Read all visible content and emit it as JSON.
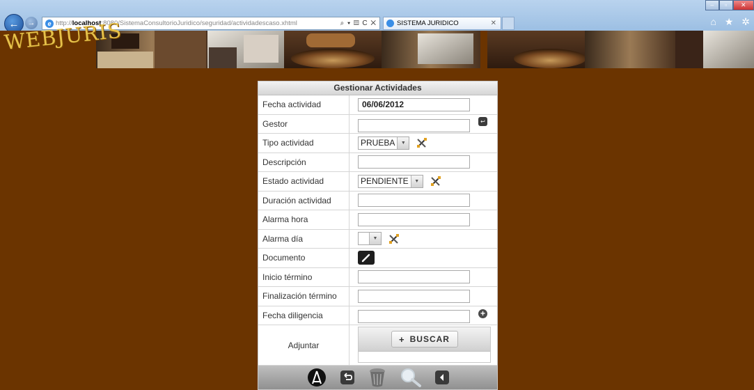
{
  "browser": {
    "url_prefix": "http://",
    "url_host": "localhost",
    "url_rest": ":8080/SistemaConsultorioJuridico/seguridad/actividadescaso.xhtml",
    "address_tools": "⌕ ▾ ▤ C ✕",
    "tab_title": "SISTEMA JURIDICO",
    "tab_close": "✕",
    "win_min": "–",
    "win_max": "▫",
    "win_close": "✕",
    "right_icons": "⌂ ★ ✲",
    "back_glyph": "←",
    "fwd_glyph": "→"
  },
  "banner": {
    "logo_text": "WEBJURIS"
  },
  "form": {
    "title": "Gestionar Actividades",
    "fields": [
      {
        "label": "Fecha actividad",
        "value": "06/06/2012"
      },
      {
        "label": "Gestor",
        "value": ""
      },
      {
        "label": "Tipo actividad",
        "selected": "PRUEBA"
      },
      {
        "label": "Descripción",
        "value": ""
      },
      {
        "label": "Estado actividad",
        "selected": "PENDIENTE"
      },
      {
        "label": "Duración actividad",
        "value": ""
      },
      {
        "label": "Alarma hora",
        "value": ""
      },
      {
        "label": "Alarma día",
        "selected": ""
      },
      {
        "label": "Documento"
      },
      {
        "label": "Inicio término",
        "value": ""
      },
      {
        "label": "Finalización término",
        "value": ""
      },
      {
        "label": "Fecha diligencia",
        "value": ""
      },
      {
        "label": "Adjuntar"
      }
    ],
    "upload_button": "BUSCAR",
    "upload_plus": "+"
  },
  "colors": {
    "page_bg": "#6b3400",
    "logo": "#e6c14a",
    "panel_header": "#d6d6d6"
  }
}
